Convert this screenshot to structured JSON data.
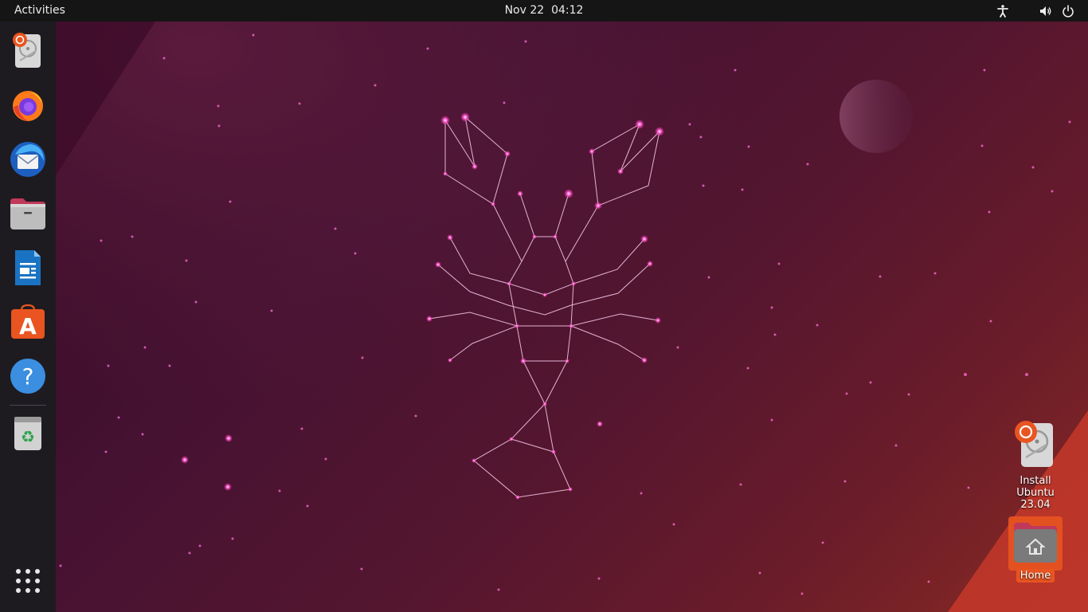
{
  "topbar": {
    "activities_label": "Activities",
    "date": "Nov 22",
    "time": "04:12",
    "icons": [
      "accessibility-icon",
      "volume-icon",
      "power-icon"
    ]
  },
  "dock": {
    "apps": [
      {
        "name": "install-ubuntu",
        "icon": "installer-icon"
      },
      {
        "name": "firefox",
        "icon": "firefox-icon"
      },
      {
        "name": "thunderbird",
        "icon": "thunderbird-icon"
      },
      {
        "name": "files",
        "icon": "files-icon"
      },
      {
        "name": "libreoffice-writer",
        "icon": "writer-icon"
      },
      {
        "name": "ubuntu-software",
        "icon": "software-icon"
      },
      {
        "name": "help",
        "icon": "help-icon"
      },
      {
        "name": "trash",
        "icon": "trash-icon"
      },
      {
        "name": "show-applications",
        "icon": "app-grid-icon"
      }
    ]
  },
  "desktop": {
    "install_label_line1": "Install Ubuntu",
    "install_label_line2": "23.04",
    "home_label": "Home"
  },
  "colors": {
    "accent": "#e95420",
    "topbar": "#151515",
    "dock": "#1d1b20",
    "constellation": "#ff4fc8"
  }
}
